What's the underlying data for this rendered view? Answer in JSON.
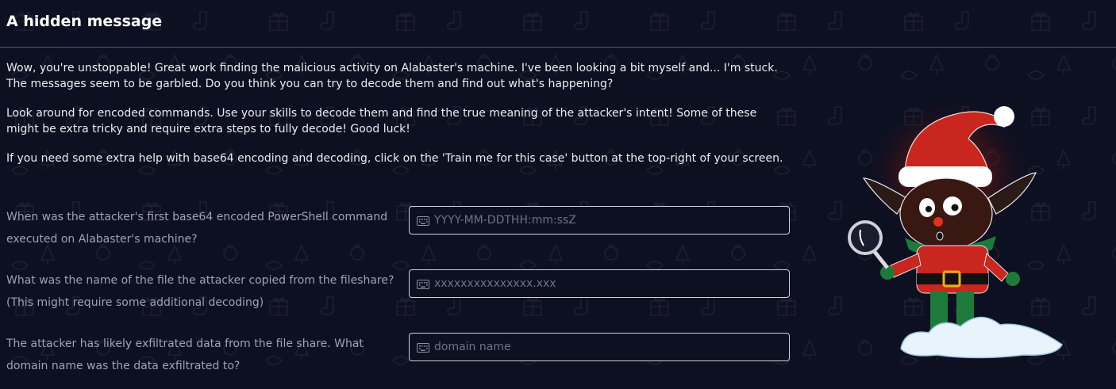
{
  "page": {
    "title": "A hidden message",
    "intro": [
      "Wow, you're unstoppable! Great work finding the malicious activity on Alabaster's machine. I've been looking a bit myself and... I'm stuck. The messages seem to be garbled. Do you think you can try to decode them and find out what's happening?",
      "Look around for encoded commands. Use your skills to decode them and find the true meaning of the attacker's intent! Some of these might be extra tricky and require extra steps to fully decode! Good luck!",
      "If you need some extra help with base64 encoding and decoding, click on the 'Train me for this case' button at the top-right of your screen."
    ]
  },
  "questions": [
    {
      "label": "When was the attacker's first base64 encoded PowerShell command executed on Alabaster's machine?",
      "placeholder": "YYYY-MM-DDTHH:mm:ssZ",
      "value": "",
      "icon": "keyboard-icon"
    },
    {
      "label": "What was the name of the file the attacker copied from the fileshare? (This might require some additional decoding)",
      "placeholder": "xxxxxxxxxxxxxxx.xxx",
      "value": "",
      "icon": "keyboard-icon"
    },
    {
      "label": "The attacker has likely exfiltrated data from the file share. What domain name was the data exfiltrated to?",
      "placeholder": "domain name",
      "value": "",
      "icon": "keyboard-icon"
    }
  ],
  "illustration": {
    "icon": "elf-detective-illustration"
  },
  "colors": {
    "background": "#0d1021",
    "text": "#ececf1",
    "muted": "#9fa2b3",
    "input_border": "#cfd1da",
    "elf_red": "#c8261f",
    "elf_green": "#1f6b2e"
  }
}
